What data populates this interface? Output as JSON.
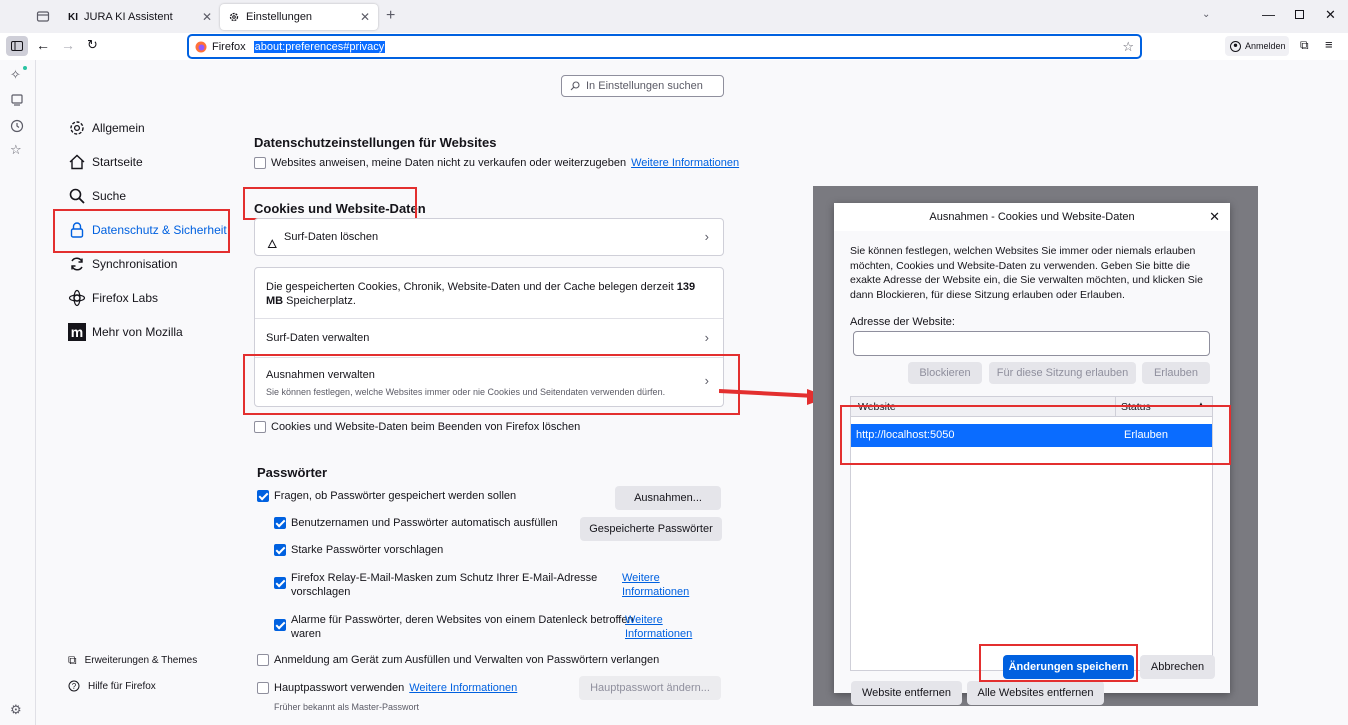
{
  "tabs": [
    {
      "label": "JURA KI Assistent",
      "icon_text": "KI"
    },
    {
      "label": "Einstellungen"
    }
  ],
  "urlbar": {
    "identity": "Firefox",
    "url": "about:preferences#privacy"
  },
  "account_label": "Anmelden",
  "search_placeholder": "In Einstellungen suchen",
  "categories": [
    {
      "label": "Allgemein",
      "icon": "gear-icon"
    },
    {
      "label": "Startseite",
      "icon": "home-icon"
    },
    {
      "label": "Suche",
      "icon": "search-icon"
    },
    {
      "label": "Datenschutz & Sicherheit",
      "icon": "lock-icon",
      "selected": true
    },
    {
      "label": "Synchronisation",
      "icon": "sync-icon"
    },
    {
      "label": "Firefox Labs",
      "icon": "labs-icon"
    },
    {
      "label": "Mehr von Mozilla",
      "icon": "mozilla-icon"
    }
  ],
  "footer": {
    "extensions": "Erweiterungen & Themes",
    "help": "Hilfe für Firefox"
  },
  "privacy": {
    "heading": "Datenschutzeinstellungen für Websites",
    "dns_label": "Websites anweisen, meine Daten nicht zu verkaufen oder weiterzugeben",
    "dns_link": "Weitere Informationen"
  },
  "cookies": {
    "heading": "Cookies und Website-Daten",
    "clear_label": "Surf-Daten löschen",
    "usage_text_pre": "Die gespeicherten Cookies, Chronik, Website-Daten und der Cache belegen derzeit",
    "usage_size": "139 MB",
    "usage_text_post": "Speicherplatz.",
    "manage_label": "Surf-Daten verwalten",
    "exceptions_label": "Ausnahmen verwalten",
    "exceptions_desc": "Sie können festlegen, welche Websites immer oder nie Cookies und Seitendaten verwenden dürfen.",
    "delete_on_close": "Cookies und Website-Daten beim Beenden von Firefox löschen"
  },
  "passwords": {
    "heading": "Passwörter",
    "ask_save": "Fragen, ob Passwörter gespeichert werden sollen",
    "exceptions_btn": "Ausnahmen...",
    "autofill": "Benutzernamen und Passwörter automatisch ausfüllen",
    "saved_btn": "Gespeicherte Passwörter",
    "suggest": "Starke Passwörter vorschlagen",
    "relay_line1": "Firefox Relay-E-Mail-Masken zum Schutz Ihrer E-Mail-Adresse",
    "relay_line2": "vorschlagen",
    "breach_line1": "Alarme für Passwörter, deren Websites von einem Datenleck betroffen",
    "breach_line2": "waren",
    "link_line1": "Weitere",
    "link_line2": "Informationen",
    "device_auth": "Anmeldung am Gerät zum Ausfüllen und Verwalten von Passwörtern verlangen",
    "primary": "Hauptpasswort verwenden",
    "primary_link": "Weitere Informationen",
    "primary_btn": "Hauptpasswort ändern...",
    "primary_note": "Früher bekannt als Master-Passwort"
  },
  "dialog": {
    "title": "Ausnahmen - Cookies und Website-Daten",
    "description": "Sie können festlegen, welchen Websites Sie immer oder niemals erlauben möchten, Cookies und Website-Daten zu verwenden. Geben Sie bitte die exakte Adresse der Website ein, die Sie verwalten möchten, und klicken Sie dann Blockieren, für diese Sitzung erlauben oder Erlauben.",
    "address_label": "Adresse der Website:",
    "block_btn": "Blockieren",
    "session_btn": "Für diese Sitzung erlauben",
    "allow_btn": "Erlauben",
    "col_website": "Website",
    "col_status": "Status",
    "rows": [
      {
        "website": "http://localhost:5050",
        "status": "Erlauben"
      }
    ],
    "remove_btn": "Website entfernen",
    "remove_all_btn": "Alle Websites entfernen",
    "save_btn": "Änderungen speichern",
    "cancel_btn": "Abbrechen"
  },
  "colors": {
    "accent": "#0061e0",
    "annotation": "#e32f2f"
  }
}
